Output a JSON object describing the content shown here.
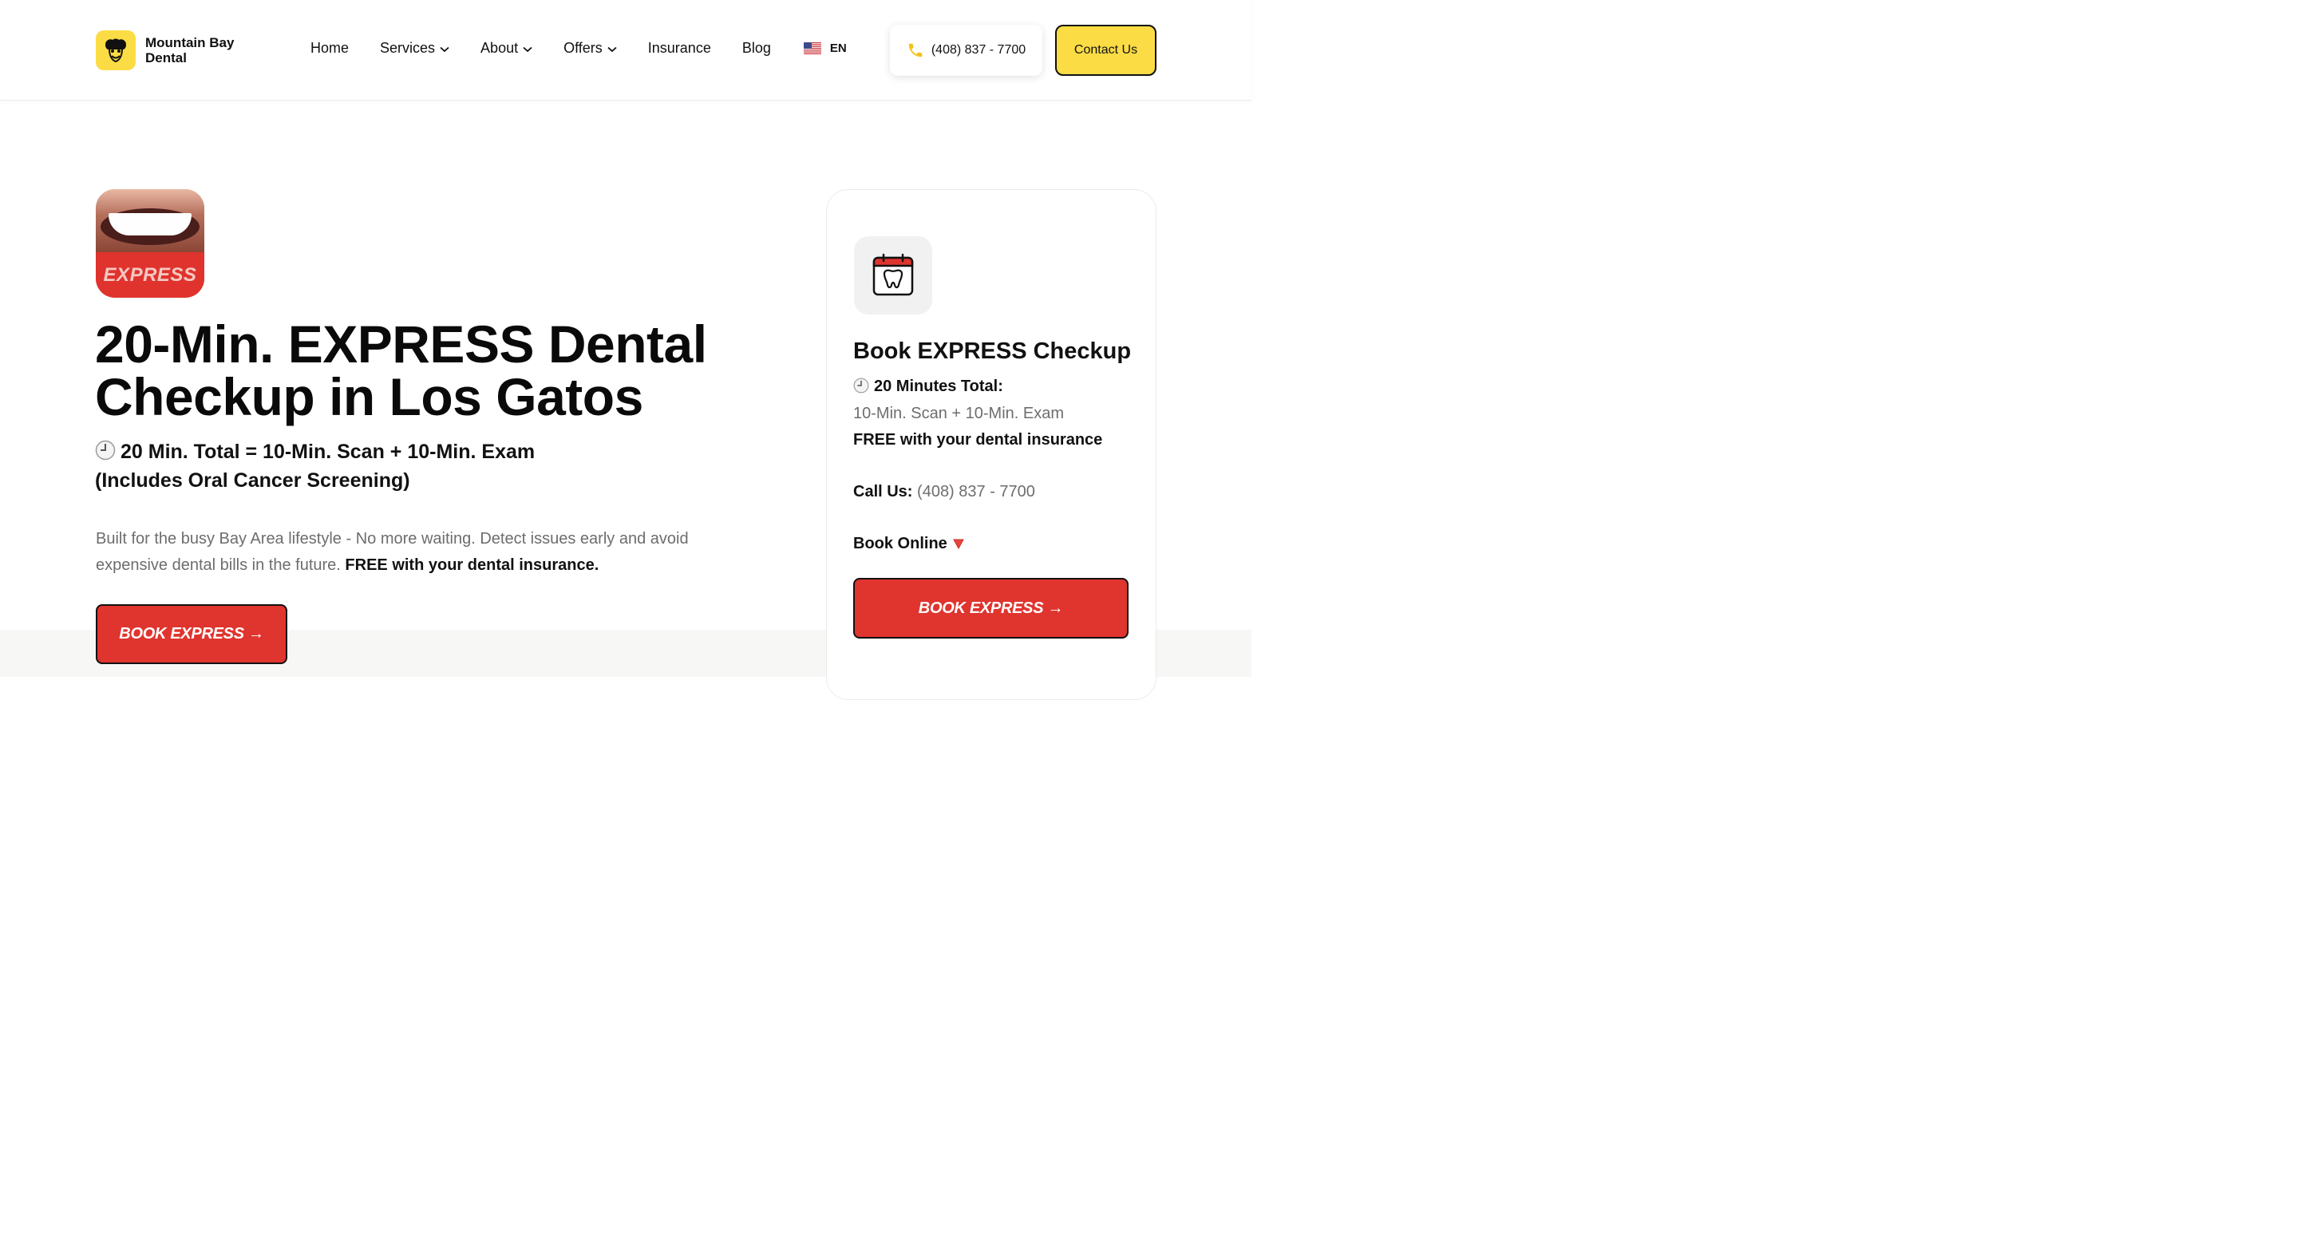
{
  "brand": {
    "name": "Mountain Bay Dental",
    "accent_color": "#fbdc45",
    "cta_color": "#e0342e"
  },
  "nav": {
    "items": [
      {
        "label": "Home",
        "has_dropdown": false
      },
      {
        "label": "Services",
        "has_dropdown": true
      },
      {
        "label": "About",
        "has_dropdown": true
      },
      {
        "label": "Offers",
        "has_dropdown": true
      },
      {
        "label": "Insurance",
        "has_dropdown": false
      },
      {
        "label": "Blog",
        "has_dropdown": false
      }
    ],
    "language": "EN",
    "phone": "(408) 837 - 7700",
    "contact_label": "Contact Us"
  },
  "hero": {
    "badge_text": "EXPRESS",
    "title": "20-Min. EXPRESS Dental Checkup in Los Gatos",
    "subtitle_line1": "20 Min. Total = 10-Min. Scan + 10-Min. Exam",
    "subtitle_line2": "(Includes Oral Cancer Screening)",
    "description": "Built for the busy Bay Area lifestyle - No more waiting. Detect issues early and avoid expensive dental bills in the future.",
    "description_bold": "FREE with your dental insurance.",
    "cta_label": "BOOK EXPRESS →"
  },
  "booking_card": {
    "icon": "calendar-tooth-icon",
    "title": "Book EXPRESS Checkup",
    "duration_label": "20 Minutes Total:",
    "duration_detail": "10-Min. Scan + 10-Min. Exam",
    "insurance_note": "FREE with your dental insurance",
    "call_label": "Call Us:",
    "call_number": "(408) 837 - 7700",
    "book_online_label": "Book Online",
    "cta_label": "BOOK EXPRESS →"
  }
}
